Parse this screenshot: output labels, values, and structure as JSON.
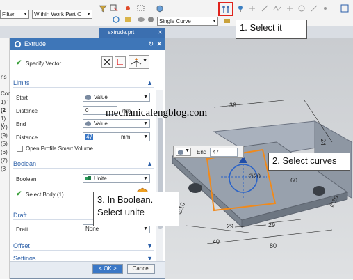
{
  "toolbar": {
    "filter_label": "Filter",
    "scope_label": "Within Work Part O",
    "curve_rule_label": "Single Curve"
  },
  "document_tab": "extrude.prt",
  "nav_strip": [
    "ns",
    "Coo",
    "1) '",
    "(2",
    "1) V",
    "(7)",
    "(9)",
    "(5)",
    "(6)",
    "(7)",
    "(8"
  ],
  "dialog": {
    "title": "Extrude",
    "specify_vector": "Specify Vector",
    "limits": {
      "header": "Limits",
      "start_label": "Start",
      "start_value": "Value",
      "distance1_label": "Distance",
      "distance1_value": "0",
      "distance1_unit": "mm",
      "end_label": "End",
      "end_value": "Value",
      "distance2_label": "Distance",
      "distance2_value": "47",
      "distance2_unit": "mm",
      "open_profile": "Open Profile Smart Volume"
    },
    "boolean": {
      "header": "Boolean",
      "boolean_label": "Boolean",
      "boolean_value": "Unite",
      "select_body": "Select Body (1)"
    },
    "draft": {
      "header": "Draft",
      "draft_label": "Draft",
      "draft_value": "None"
    },
    "offset_header": "Offset",
    "settings_header": "Settings",
    "ok_label": "< OK >",
    "cancel_label": "Cancel"
  },
  "endbar": {
    "label": "End",
    "value": "47"
  },
  "callouts": {
    "step1": "1. Select it",
    "step2": "2. Select curves",
    "step3_line1": "3. In Boolean.",
    "step3_line2": "Select unite"
  },
  "watermark": "mechanicalengblog.com",
  "dimensions": {
    "d36": "36",
    "d24": "24",
    "d60": "60",
    "d29a": "29",
    "d29b": "29",
    "d40": "40",
    "d80": "80",
    "d10a": "∅10",
    "d10b": "∅10",
    "d20": "∅20"
  }
}
